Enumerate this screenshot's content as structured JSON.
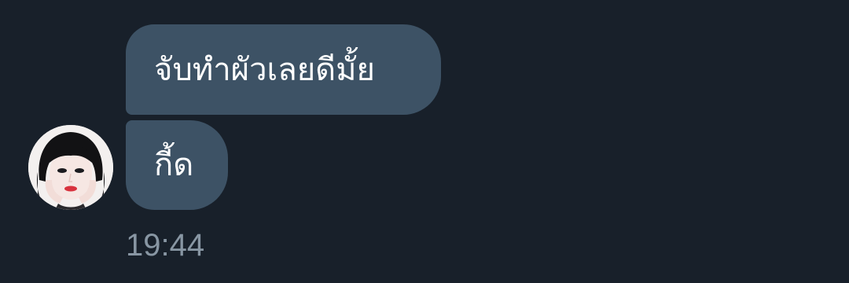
{
  "thread": {
    "messages": [
      {
        "text": "จับทำผัวเลยดีมั้ย"
      },
      {
        "text": "กี้ด"
      }
    ],
    "timestamp": "19:44",
    "avatar": {
      "icon": "user-avatar-photo"
    }
  },
  "colors": {
    "background": "#18202a",
    "bubble": "#3d5265",
    "message_text": "#ffffff",
    "timestamp_text": "#8896a3"
  }
}
